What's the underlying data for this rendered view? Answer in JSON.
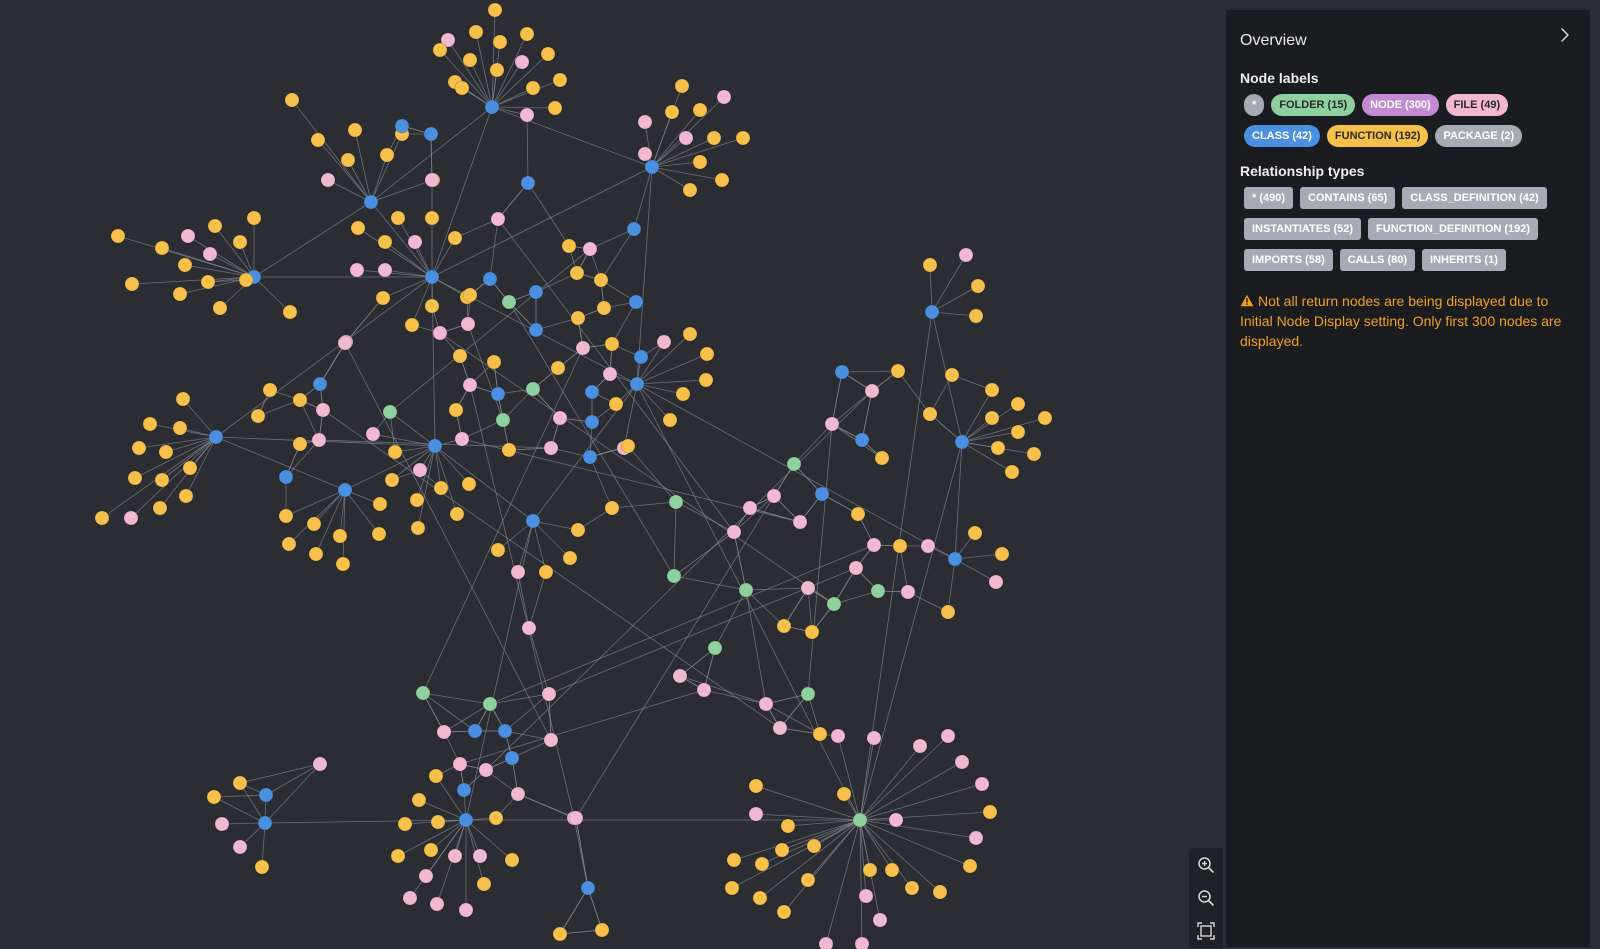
{
  "panel": {
    "title": "Overview",
    "node_labels_title": "Node labels",
    "node_labels": [
      {
        "label": "*",
        "color": "#a5a9b2",
        "dark_text": false
      },
      {
        "label": "FOLDER (15)",
        "color": "#8fd19e",
        "dark_text": true
      },
      {
        "label": "NODE (300)",
        "color": "#c38ad3",
        "dark_text": false
      },
      {
        "label": "FILE (49)",
        "color": "#f2b8cf",
        "dark_text": true
      },
      {
        "label": "CLASS (42)",
        "color": "#4a8fe0",
        "dark_text": false
      },
      {
        "label": "FUNCTION (192)",
        "color": "#f7c04a",
        "dark_text": true
      },
      {
        "label": "PACKAGE (2)",
        "color": "#a7abb5",
        "dark_text": false
      }
    ],
    "relationship_types_title": "Relationship types",
    "relationship_types": [
      "* (490)",
      "CONTAINS (65)",
      "CLASS_DEFINITION (42)",
      "INSTANTIATES (52)",
      "FUNCTION_DEFINITION (192)",
      "IMPORTS (58)",
      "CALLS (80)",
      "INHERITS (1)"
    ],
    "warning": "Not all return nodes are being displayed due to Initial Node Display setting. Only first 300 nodes are displayed."
  },
  "zoom_controls": {
    "zoom_in_icon": "zoom-in-icon",
    "zoom_out_icon": "zoom-out-icon",
    "fit_icon": "fit-to-screen-icon"
  },
  "graph": {
    "node_colors": {
      "function": "#f7c04a",
      "class": "#4a8fe0",
      "file": "#f2b8cf",
      "folder": "#8fd19e",
      "edge": "#8a8d96"
    }
  }
}
